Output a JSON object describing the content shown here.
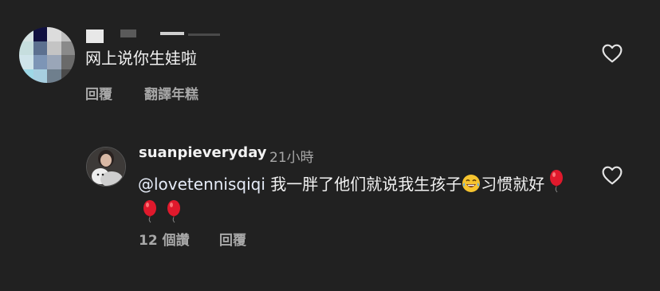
{
  "comments": [
    {
      "text": "网上说你生娃啦",
      "reply_label": "回覆",
      "translate_label": "翻譯年糕"
    }
  ],
  "reply": {
    "username": "suanpieveryday",
    "timestamp": "21小時",
    "mention": "@lovetennisqiqi",
    "text_part1": " 我一胖了他们就说我生孩子",
    "text_part2": "习惯就好",
    "likes_label": "12 個讚",
    "reply_label": "回覆"
  },
  "icons": {
    "heart": "heart-outline-icon",
    "laugh_emoji": "face-with-tears-of-joy",
    "balloon_emoji": "balloon"
  },
  "colors": {
    "background": "#212121",
    "primary_text": "#f2f2f2",
    "secondary_text": "#a8a8a8",
    "balloon": "#e0192c"
  }
}
